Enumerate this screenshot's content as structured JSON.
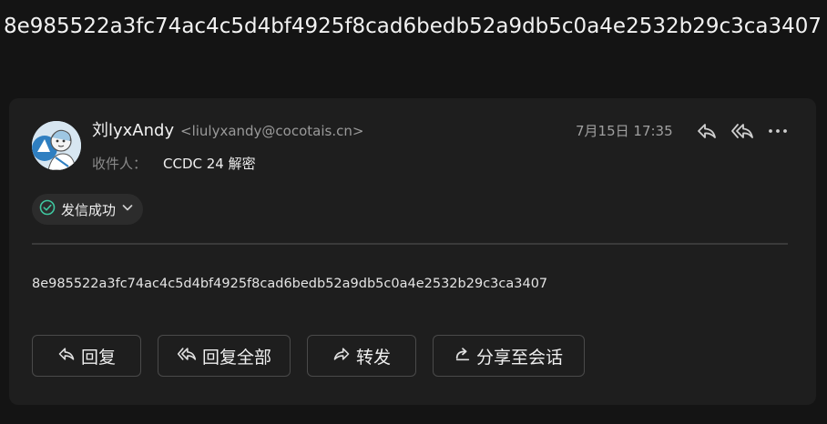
{
  "subject": "8e985522a3fc74ac4c5d4bf4925f8cad6bedb52a9db5c0a4e2532b29c3ca3407",
  "sender": {
    "name": "刘lyxAndy",
    "email": "<liulyxandy@cocotais.cn>"
  },
  "recipients": {
    "label": "收件人：",
    "value": "CCDC 24 解密"
  },
  "timestamp": "7月15日 17:35",
  "status": {
    "label": "发信成功",
    "color": "#3fc7a0"
  },
  "body": "8e985522a3fc74ac4c5d4bf4925f8cad6bedb52a9db5c0a4e2532b29c3ca3407",
  "actions": {
    "reply": "回复",
    "reply_all": "回复全部",
    "forward": "转发",
    "share": "分享至会话"
  },
  "icons": {
    "reply": "reply-icon",
    "reply_all": "reply-all-icon",
    "more": "more-icon",
    "forward": "forward-icon",
    "share": "share-icon",
    "status": "check-circle-icon",
    "chevron": "chevron-down-icon"
  }
}
